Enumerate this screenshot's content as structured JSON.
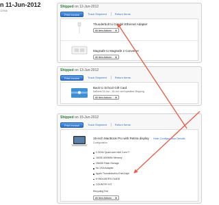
{
  "order": {
    "title": "n 11-Jun-2012",
    "number": "12945"
  },
  "labels": {
    "shipped": "Shipped",
    "on": "on"
  },
  "buttons": {
    "print": "Print Invoice",
    "track": "Track Shipment",
    "return": "Return Items"
  },
  "item_actions": "All Item Actions",
  "item_actions_chevron": "⬍",
  "shipments": [
    {
      "date": "12-Jun-2012",
      "items": [
        {
          "name": "Thunderbolt to Gigabit Ethernet Adapter"
        },
        {
          "name": "MagSafe to MagSafe 2 Converter"
        }
      ]
    },
    {
      "date": "13-Jun-2012",
      "items": [
        {
          "name": "Back to School Gift Card",
          "note": "Delivers 15-Jun - 18-Jun via Expedited Shipping"
        }
      ]
    },
    {
      "date": "15-Jun-2012",
      "items": [
        {
          "name": "15-inch MacBook Pro with Retina display",
          "sub": "Configuration",
          "hide_link": "Hide Configuration Details",
          "config": [
            "2.3GHz Quad-core Intel Core i7",
            "16GB 1600MHz Memory",
            "256GB Flash Storage",
            "No VGA Adapter",
            "Apple Thunderbolt to Enet Adpt",
            "KYBD/USER'S GUIDE",
            "COUNTRY KIT"
          ],
          "extra": "Recycling Fee"
        }
      ]
    }
  ],
  "colors": {
    "arrow": "#e8604c",
    "link": "#2a6bbf",
    "shipped": "#2d7a3a"
  }
}
